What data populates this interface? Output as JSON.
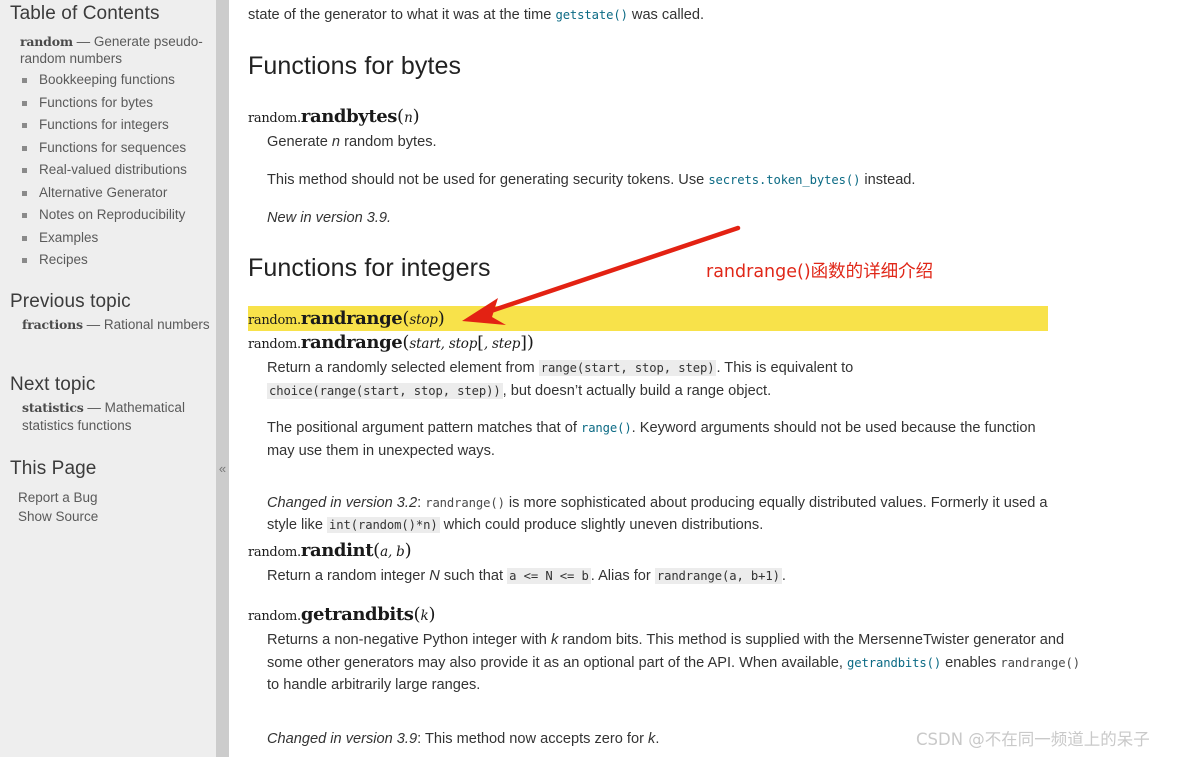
{
  "sidebar": {
    "toc": {
      "title": "Table of Contents",
      "intro_mono": "random",
      "intro_rest": " — Generate pseudo-random numbers",
      "items": [
        {
          "label": "Bookkeeping functions"
        },
        {
          "label": "Functions for bytes"
        },
        {
          "label": "Functions for integers"
        },
        {
          "label": "Functions for sequences"
        },
        {
          "label": "Real-valued distributions"
        },
        {
          "label": "Alternative Generator"
        },
        {
          "label": "Notes on Reproducibility"
        },
        {
          "label": "Examples"
        },
        {
          "label": "Recipes"
        }
      ]
    },
    "previous_topic": {
      "title": "Previous topic",
      "mono": "fractions",
      "rest": " — Rational numbers"
    },
    "next_topic": {
      "title": "Next topic",
      "mono": "statistics",
      "rest": " — Mathematical statistics functions"
    },
    "this_page": {
      "title": "This Page",
      "links": [
        "Report a Bug",
        "Show Source"
      ]
    },
    "collapse_glyph": "«"
  },
  "main": {
    "top_partial": {
      "before": "state of the generator to what it was at the time ",
      "code": "getstate()",
      "after": " was called."
    },
    "bytes_section": {
      "heading": "Functions for bytes",
      "sig": {
        "prefix": "random.",
        "name": "randbytes",
        "params": "n"
      },
      "desc_before": "Generate ",
      "desc_em": "n",
      "desc_after": " random bytes.",
      "note_before": "This method should not be used for generating security tokens. Use ",
      "note_code": "secrets.token_bytes()",
      "note_after": " instead.",
      "version_added": "New in version 3.9."
    },
    "integers_section": {
      "heading": "Functions for integers",
      "randrange_sig1": {
        "prefix": "random.",
        "name": "randrange",
        "params": "stop"
      },
      "randrange_sig2": {
        "prefix": "random.",
        "name": "randrange",
        "params_a": "start, stop",
        "params_b": ", step"
      },
      "randrange_desc": {
        "p1_a": "Return a randomly selected element from ",
        "p1_code1": "range(start, stop, step)",
        "p1_b": ". This is equivalent to",
        "p2_code": "choice(range(start, stop, step))",
        "p2_b": ", but doesn’t actually build a range object."
      },
      "positional_note": {
        "a": "The positional argument pattern matches that of ",
        "code": "range()",
        "b": ". Keyword arguments should not be used because",
        "c": "the function may use them in unexpected ways."
      },
      "changed_32": {
        "label": "Changed in version 3.2",
        "colon": ": ",
        "code1": "randrange()",
        "a": " is more sophisticated about producing equally distributed values.",
        "b": "Formerly it used a style like ",
        "code2": "int(random()*n)",
        "c": " which could produce slightly uneven distributions."
      },
      "randint_sig": {
        "prefix": "random.",
        "name": "randint",
        "params": "a, b"
      },
      "randint_desc": {
        "a": "Return a random integer ",
        "em": "N",
        "b": " such that ",
        "code1": "a <= N <= b",
        "c": ". Alias for ",
        "code2": "randrange(a, b+1)",
        "d": "."
      },
      "getrandbits_sig": {
        "prefix": "random.",
        "name": "getrandbits",
        "params": "k"
      },
      "getrandbits_desc": {
        "a": "Returns a non-negative Python integer with ",
        "em": "k",
        "b": " random bits. This method is supplied with the MersenneTwister",
        "c": "generator and some other generators may also provide it as an optional part of the API. When available,",
        "code1": "getrandbits()",
        "d": " enables ",
        "code2": "randrange()",
        "e": " to handle arbitrarily large ranges."
      },
      "changed_39": {
        "label": "Changed in version 3.9",
        "colon": ": ",
        "text": "This method now accepts zero for ",
        "em": "k",
        "tail": "."
      }
    }
  },
  "annotation": {
    "text": "randrange()函数的详细介绍",
    "color": "#e02718"
  },
  "watermark": {
    "text": "CSDN @不在同一频道上的呆子"
  },
  "colors": {
    "highlight": "#f8e24a",
    "sidebar_bg": "#eeeeee",
    "collapse_bar": "#cccccc",
    "code_link": "#0b6a84",
    "inline_code_bg": "#ececec"
  }
}
